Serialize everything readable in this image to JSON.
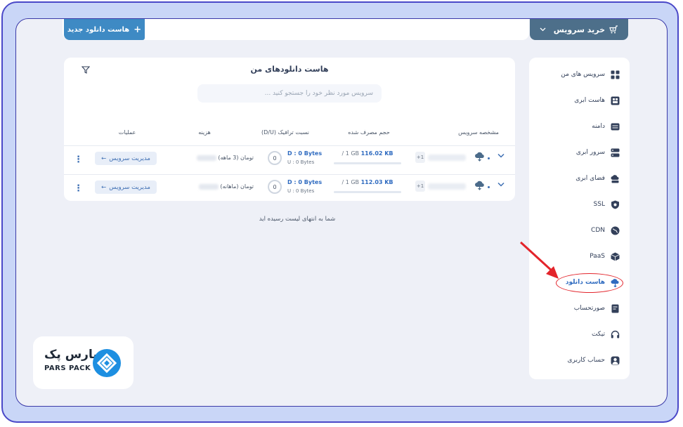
{
  "toolbar": {
    "new_button_label": "هاست دانلود جدید",
    "buy_button_label": "خرید سرویس"
  },
  "main": {
    "title": "هاست دانلودهای من",
    "search_placeholder": "سرویس مورد نظر خود را جستجو کنید ...",
    "columns": [
      "مشخصه سرویس",
      "حجم مصرف شده",
      "نسبت ترافیک (D/U)",
      "هزینه",
      "عملیات"
    ],
    "rows": [
      {
        "service_chip": "+1",
        "usage_used": "116.02 KB",
        "usage_total": "/ 1 GB",
        "usage_fraction": 0.0001,
        "traffic_ratio": "0",
        "download": "D : 0 Bytes",
        "upload": "U : 0 Bytes",
        "cost": "تومان (3 ماهه)",
        "manage_label": "مدیریت سرویس"
      },
      {
        "service_chip": "+1",
        "usage_used": "112.03 KB",
        "usage_total": "/ 1 GB",
        "usage_fraction": 0.0001,
        "traffic_ratio": "0",
        "download": "D : 0 Bytes",
        "upload": "U : 0 Bytes",
        "cost": "تومان (ماهانه)",
        "manage_label": "مدیریت سرویس"
      }
    ],
    "end_of_list": "شما به انتهای لیست رسیده اید"
  },
  "sidebar": {
    "items": [
      {
        "label": "سرویس های من",
        "icon": "grid-icon"
      },
      {
        "label": "هاست ابری",
        "icon": "cloud-host-icon"
      },
      {
        "label": "دامنه",
        "icon": "domain-icon"
      },
      {
        "label": "سرور ابری",
        "icon": "server-icon"
      },
      {
        "label": "فضای ابری",
        "icon": "storage-icon"
      },
      {
        "label": "SSL",
        "icon": "shield-icon"
      },
      {
        "label": "CDN",
        "icon": "globe-icon"
      },
      {
        "label": "PaaS",
        "icon": "cube-icon"
      },
      {
        "label": "هاست دانلود",
        "icon": "cloud-download-icon",
        "active": true
      },
      {
        "label": "صورتحساب",
        "icon": "invoice-icon"
      },
      {
        "label": "تیکت",
        "icon": "headset-icon"
      },
      {
        "label": "حساب کاربری",
        "icon": "user-icon"
      }
    ]
  },
  "logo": {
    "name_fa": "پارس پک",
    "name_en": "PARS PACK"
  },
  "colors": {
    "accent": "#3e8ac4",
    "buy_button": "#4d6f8a",
    "highlight": "#e3242b",
    "frame": "#4a48c8"
  }
}
